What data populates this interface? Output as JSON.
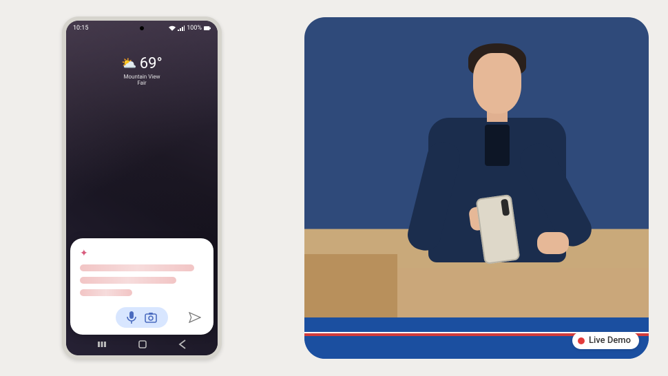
{
  "status": {
    "time": "10:15",
    "battery_text": "100%"
  },
  "weather": {
    "temp": "69°",
    "location": "Mountain View",
    "condition": "Fair",
    "icon_name": "weather-partly-cloudy-icon"
  },
  "dock": {
    "items": [
      {
        "name": "fitness-app-icon"
      },
      {
        "name": "app-drawer-icon"
      },
      {
        "name": "assistant-gem-icon"
      },
      {
        "name": "photos-app-icon"
      }
    ]
  },
  "assistant_card": {
    "spark_icon": "spark-icon",
    "mic_icon": "mic-icon",
    "camera_icon": "camera-icon",
    "send_icon": "send-icon",
    "placeholder_lines": 3
  },
  "nav": {
    "recents": "recents-icon",
    "home": "home-icon",
    "back": "back-icon"
  },
  "badge_text": "Live Demo"
}
